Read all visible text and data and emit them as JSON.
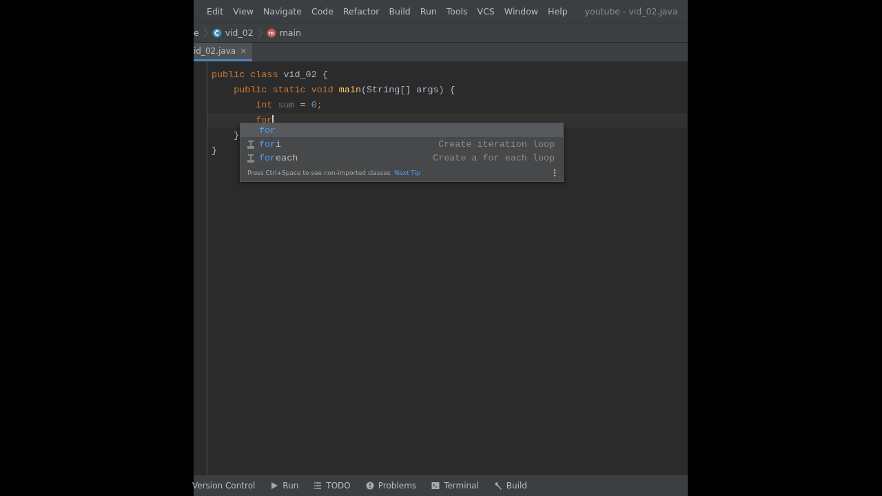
{
  "menu": [
    "Edit",
    "View",
    "Navigate",
    "Code",
    "Refactor",
    "Build",
    "Run",
    "Tools",
    "VCS",
    "Window",
    "Help"
  ],
  "window": {
    "title": "youtube - vid_02.java"
  },
  "breadcrumbs": [
    {
      "label": "e",
      "kind": "plain"
    },
    {
      "label": "vid_02",
      "kind": "class"
    },
    {
      "label": "main",
      "kind": "method"
    }
  ],
  "tabs": [
    {
      "label": "id_02.java",
      "selected": true,
      "close": "×"
    }
  ],
  "code_lines": [
    {
      "caret": false,
      "tokens": [
        {
          "t": "public class ",
          "kind": "keyword"
        },
        {
          "t": "vid_02 {",
          "kind": "plain"
        }
      ]
    },
    {
      "caret": false,
      "tokens": [
        {
          "t": "    public static void ",
          "kind": "keyword"
        },
        {
          "t": "main",
          "kind": "method"
        },
        {
          "t": "(String[] args) {",
          "kind": "plain"
        }
      ]
    },
    {
      "caret": false,
      "tokens": [
        {
          "t": "        int ",
          "kind": "keyword"
        },
        {
          "t": "sum",
          "kind": "unused"
        },
        {
          "t": " = ",
          "kind": "plain"
        },
        {
          "t": "0",
          "kind": "number"
        },
        {
          "t": ";",
          "kind": "keyword"
        }
      ]
    },
    {
      "caret": true,
      "tokens": [
        {
          "t": "        for",
          "kind": "keyword"
        }
      ]
    },
    {
      "caret": false,
      "tokens": [
        {
          "t": "    }",
          "kind": "plain"
        }
      ]
    },
    {
      "caret": false,
      "tokens": [
        {
          "t": "}",
          "kind": "plain"
        }
      ]
    }
  ],
  "completion": {
    "items": [
      {
        "match": "for",
        "template": false,
        "selected": true
      },
      {
        "match": "for",
        "rest": "i",
        "hint": "Create iteration loop",
        "template": true,
        "selected": false
      },
      {
        "match": "for",
        "rest": "each",
        "hint": "Create a for each loop",
        "template": true,
        "selected": false
      }
    ],
    "tip": "Press Ctrl+Space to see non-imported classes",
    "tip_link": "Next Tip"
  },
  "tool_windows": [
    {
      "label": "Version Control",
      "kind": "vcs"
    },
    {
      "label": "Run",
      "kind": "run"
    },
    {
      "label": "TODO",
      "kind": "todo"
    },
    {
      "label": "Problems",
      "kind": "problems"
    },
    {
      "label": "Terminal",
      "kind": "terminal"
    },
    {
      "label": "Build",
      "kind": "build"
    }
  ]
}
